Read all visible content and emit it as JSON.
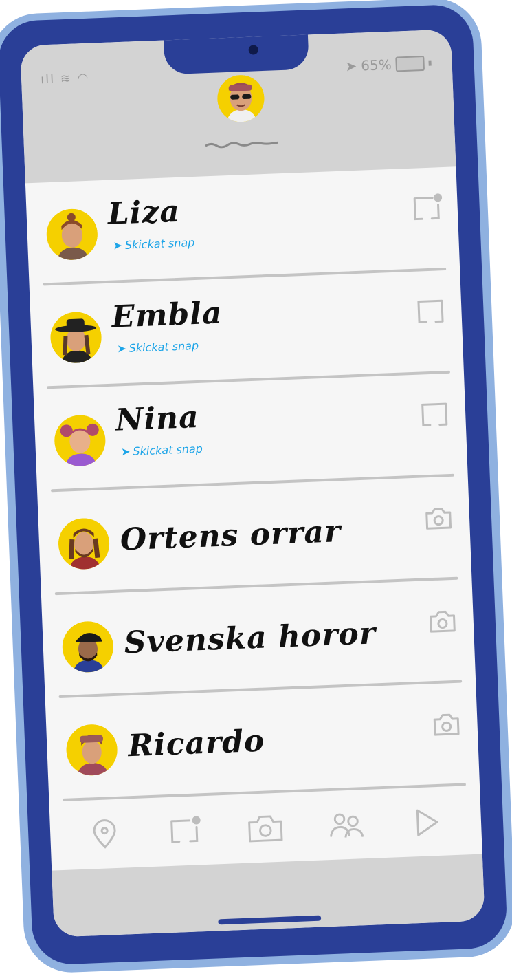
{
  "status_bar": {
    "signal": "ıll",
    "battery_percent": "65%"
  },
  "header": {
    "avatar_icon": "bitmoji-avatar-sunglasses"
  },
  "chats": [
    {
      "name": "Liza",
      "status": "Skickat snap",
      "icon": "chat-unread-icon",
      "avatar_color": "#f5d000"
    },
    {
      "name": "Embla",
      "status": "Skickat snap",
      "icon": "chat-icon",
      "avatar_color": "#f5d000"
    },
    {
      "name": "Nina",
      "status": "Skickat snap",
      "icon": "chat-icon",
      "avatar_color": "#f5d000"
    },
    {
      "name": "Ortens orrar",
      "status": "",
      "icon": "camera-icon",
      "avatar_color": "#f5d000"
    },
    {
      "name": "Svenska horor",
      "status": "",
      "icon": "camera-icon",
      "avatar_color": "#f5d000"
    },
    {
      "name": "Ricardo",
      "status": "",
      "icon": "camera-icon",
      "avatar_color": "#f5d000"
    }
  ],
  "nav": [
    "map-pin-icon",
    "chat-unread-icon",
    "camera-icon",
    "friends-icon",
    "play-icon"
  ],
  "colors": {
    "frame": "#2a3f97",
    "frame_outer": "#8fb1e0",
    "accent_status": "#1ea5e8",
    "avatar_bg": "#f5d000",
    "header_bg": "#d3d3d3"
  }
}
